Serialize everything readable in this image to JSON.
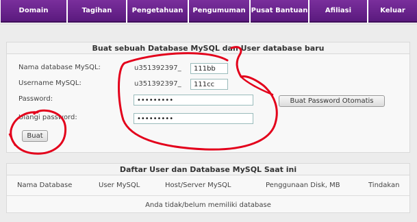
{
  "nav": {
    "tabs": [
      {
        "label": "Domain"
      },
      {
        "label": "Tagihan"
      },
      {
        "label": "Pengetahuan"
      },
      {
        "label": "Pengumuman"
      },
      {
        "label": "Pusat Bantuan"
      },
      {
        "label": "Afiliasi"
      },
      {
        "label": "Keluar"
      }
    ]
  },
  "create_form": {
    "title": "Buat sebuah Database MySQL dan User database baru",
    "db_name_label": "Nama database MySQL:",
    "db_prefix": "u351392397_",
    "db_value": "111bb",
    "username_label": "Username MySQL:",
    "user_prefix": "u351392397_",
    "user_value": "111cc",
    "password_label": "Password:",
    "password_value": "123456789",
    "repeat_label": "Ulangi password:",
    "repeat_value": "123456789",
    "auto_password_button": "Buat Password Otomatis",
    "submit_button": "Buat"
  },
  "list_panel": {
    "title": "Daftar User dan Database MySQL Saat ini",
    "columns": [
      "Nama Database",
      "User MySQL",
      "Host/Server MySQL",
      "Penggunaan Disk, MB",
      "Tindakan"
    ],
    "empty_message": "Anda tidak/belum memiliki database"
  },
  "colors": {
    "nav": "#5a1a7e",
    "annotation": "#e3001b"
  }
}
